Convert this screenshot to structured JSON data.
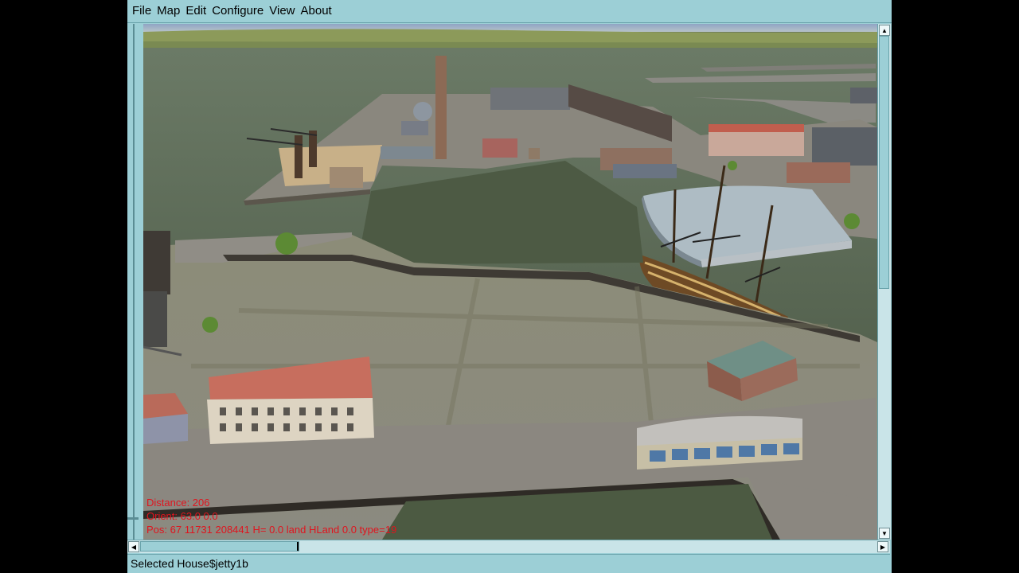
{
  "menu": {
    "items": [
      "File",
      "Map",
      "Edit",
      "Configure",
      "View",
      "About"
    ]
  },
  "overlay": {
    "distance": "Distance: 206",
    "orient": "Orient: 63.0 0.0",
    "position": "Pos: 67 11731 208441 H= 0.0 land HLand 0.0 type=19"
  },
  "status": {
    "text": "Selected House$jetty1b"
  },
  "scrollbars": {
    "up_arrow": "▲",
    "down_arrow": "▼",
    "left_arrow": "◀",
    "right_arrow": "▶"
  },
  "colors": {
    "window_chrome": "#9ccfd6",
    "overlay_text": "#e0141e",
    "water": "#4f5c48",
    "quay": "#8a8780"
  }
}
